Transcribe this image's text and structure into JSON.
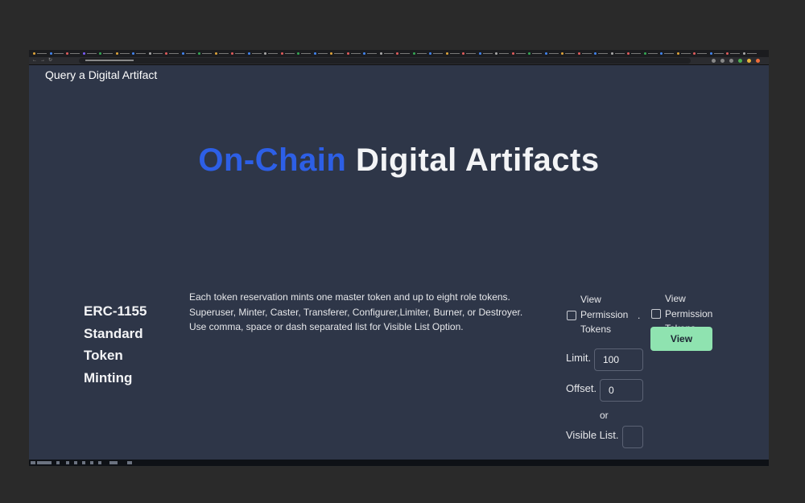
{
  "browser": {
    "tab_colors": [
      "#e0a43a",
      "#4285f4",
      "#e25c5c",
      "#7c5cff",
      "#34a853",
      "#e0a43a",
      "#4285f4",
      "#aaaaaa",
      "#e25c5c",
      "#4285f4",
      "#34a853",
      "#e0a43a",
      "#e25c5c",
      "#4285f4",
      "#aaaaaa",
      "#e25c5c",
      "#34a853",
      "#4285f4",
      "#e0a43a",
      "#e25c5c",
      "#4285f4",
      "#aaaaaa",
      "#e25c5c",
      "#34a853",
      "#4285f4",
      "#e0a43a",
      "#e25c5c",
      "#4285f4",
      "#aaaaaa",
      "#e25c5c",
      "#34a853",
      "#4285f4",
      "#e0a43a",
      "#e25c5c",
      "#4285f4",
      "#aaaaaa",
      "#e25c5c",
      "#34a853",
      "#4285f4",
      "#e0a43a",
      "#e25c5c",
      "#4285f4",
      "#e25c5c",
      "#aaaaaa"
    ],
    "extension_colors": [
      "#888888",
      "#888888",
      "#888888",
      "#4caf50",
      "#e8b339",
      "#ef6c3a"
    ]
  },
  "page": {
    "link_title": "Query a Digital Artifact",
    "hero_accent": "On-Chain",
    "hero_rest": "Digital Artifacts",
    "standard_title": "ERC-1155 Standard Token Minting",
    "description": "Each token reservation mints one master token and up to eight role tokens. Superuser, Minter, Caster, Transferer, Configurer,Limiter, Burner, or Destroyer. Use comma, space or dash separated list for Visible List Option.",
    "checkbox_1_label": "View Permission Tokens",
    "separator": ".",
    "checkbox_2_label": "View Permission Tokens",
    "limit_label": "Limit.",
    "limit_value": "100",
    "offset_label": "Offset.",
    "offset_value": "0",
    "or_label": "or",
    "visible_list_label": "Visible List.",
    "visible_list_value": "",
    "view_button": "View"
  },
  "colors": {
    "background": "#2e3648",
    "accent": "#2d5fe6",
    "button": "#8fe3b0"
  }
}
